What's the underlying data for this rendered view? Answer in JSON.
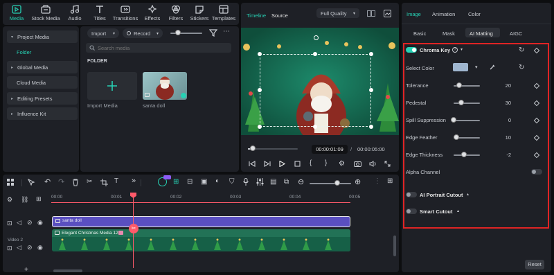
{
  "toolbar": {
    "items": [
      {
        "label": "Media",
        "icon": "media-icon"
      },
      {
        "label": "Stock Media",
        "icon": "stock-media-icon"
      },
      {
        "label": "Audio",
        "icon": "audio-icon"
      },
      {
        "label": "Titles",
        "icon": "titles-icon"
      },
      {
        "label": "Transitions",
        "icon": "transitions-icon"
      },
      {
        "label": "Effects",
        "icon": "effects-icon"
      },
      {
        "label": "Filters",
        "icon": "filters-icon"
      },
      {
        "label": "Stickers",
        "icon": "stickers-icon"
      },
      {
        "label": "Templates",
        "icon": "templates-icon"
      }
    ]
  },
  "sidebar": {
    "items": [
      {
        "label": "Project Media",
        "arrow": "▾"
      },
      {
        "label": "Folder",
        "arrow": ""
      },
      {
        "label": "Global Media",
        "arrow": "▸"
      },
      {
        "label": "Cloud Media",
        "arrow": ""
      },
      {
        "label": "Editing Presets",
        "arrow": "▸"
      },
      {
        "label": "Influence Kit",
        "arrow": "▸"
      }
    ]
  },
  "media": {
    "import_label": "Import",
    "record_label": "Record",
    "search_placeholder": "Search media",
    "folder_heading": "FOLDER",
    "tiles": [
      {
        "label": "Import Media"
      },
      {
        "label": "santa doll"
      }
    ]
  },
  "player": {
    "tab_timeline": "Timeline",
    "tab_source": "Source",
    "quality": "Full Quality",
    "current_time": "00:00:01:09",
    "separator": "/",
    "total_time": "00:00:05:00",
    "progress": 0.1
  },
  "inspector": {
    "tabs": [
      "Image",
      "Animation",
      "Color"
    ],
    "subtabs": [
      "Basic",
      "Mask",
      "AI Matting",
      "AIGC"
    ],
    "chroma_key": "Chroma Key",
    "select_color": "Select Color",
    "key_color": "#9fb6cf",
    "rows": [
      {
        "label": "Tolerance",
        "value": "20",
        "level": 0.2
      },
      {
        "label": "Pedestal",
        "value": "30",
        "level": 0.3
      },
      {
        "label": "Spill Suppression",
        "value": "0",
        "level": 0.0
      },
      {
        "label": "Edge Feather",
        "value": "10",
        "level": 0.1
      },
      {
        "label": "Edge Thickness",
        "value": "-2",
        "level": 0.4
      }
    ],
    "alpha_channel": "Alpha Channel",
    "ai_portrait": "AI Portrait Cutout",
    "smart_cutout": "Smart Cutout",
    "reset": "Reset"
  },
  "timeline": {
    "ruler": [
      "00:00",
      "00:01",
      "00:02",
      "00:03",
      "00:04",
      "00:05"
    ],
    "clip1": "santa doll",
    "clip2": "Elegant Christmas Media 12",
    "track_label": "Video 2"
  },
  "colors": {
    "accent": "#27d1b4",
    "clip_purple": "#5a4fc0",
    "clip_green": "#1f6a4e",
    "playhead": "#ff5a6a",
    "highlight_border": "#e02424"
  }
}
